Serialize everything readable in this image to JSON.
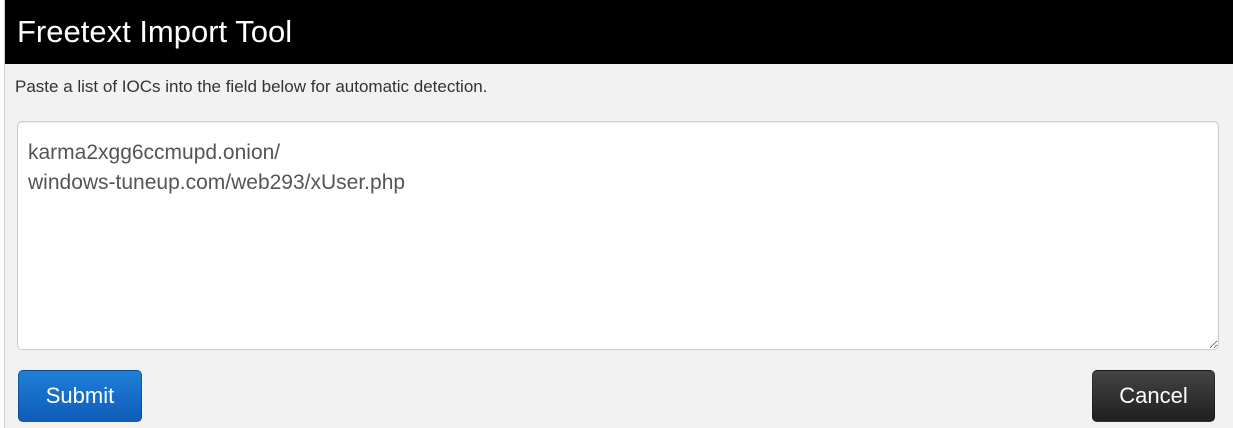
{
  "popup": {
    "title": "Freetext Import Tool",
    "instructions": "Paste a list of IOCs into the field below for automatic detection.",
    "textarea_value": "karma2xgg6ccmupd.onion/\nwindows-tuneup.com/web293/xUser.php",
    "submit_label": "Submit",
    "cancel_label": "Cancel"
  },
  "colors": {
    "title_bar": "#000000",
    "submit_button": "#0f5cb8",
    "cancel_button": "#2a2a2a"
  }
}
